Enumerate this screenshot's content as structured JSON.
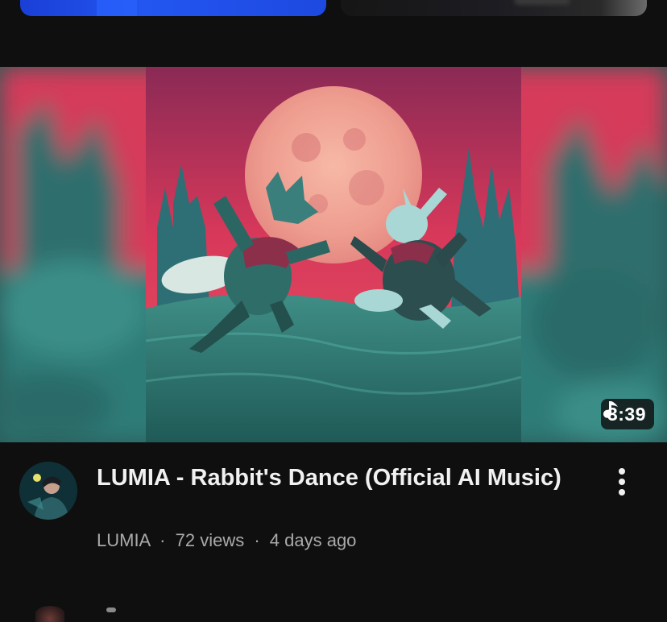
{
  "video": {
    "title": "LUMIA - Rabbit's Dance (Official AI Music)",
    "channel": "LUMIA",
    "views": "72 views",
    "age": "4 days ago",
    "separator": "·",
    "duration": "3:39",
    "badge_icon": "music-note-icon"
  },
  "icons": {
    "menu": "more-vert-icon",
    "avatar": "channel-avatar"
  },
  "colors": {
    "background": "#0f0f0f",
    "title": "#f1f1f1",
    "meta": "#aaaaaa",
    "sky": "#d93a5a",
    "moon": "#f0a59a",
    "field": "#2f7f7a"
  }
}
